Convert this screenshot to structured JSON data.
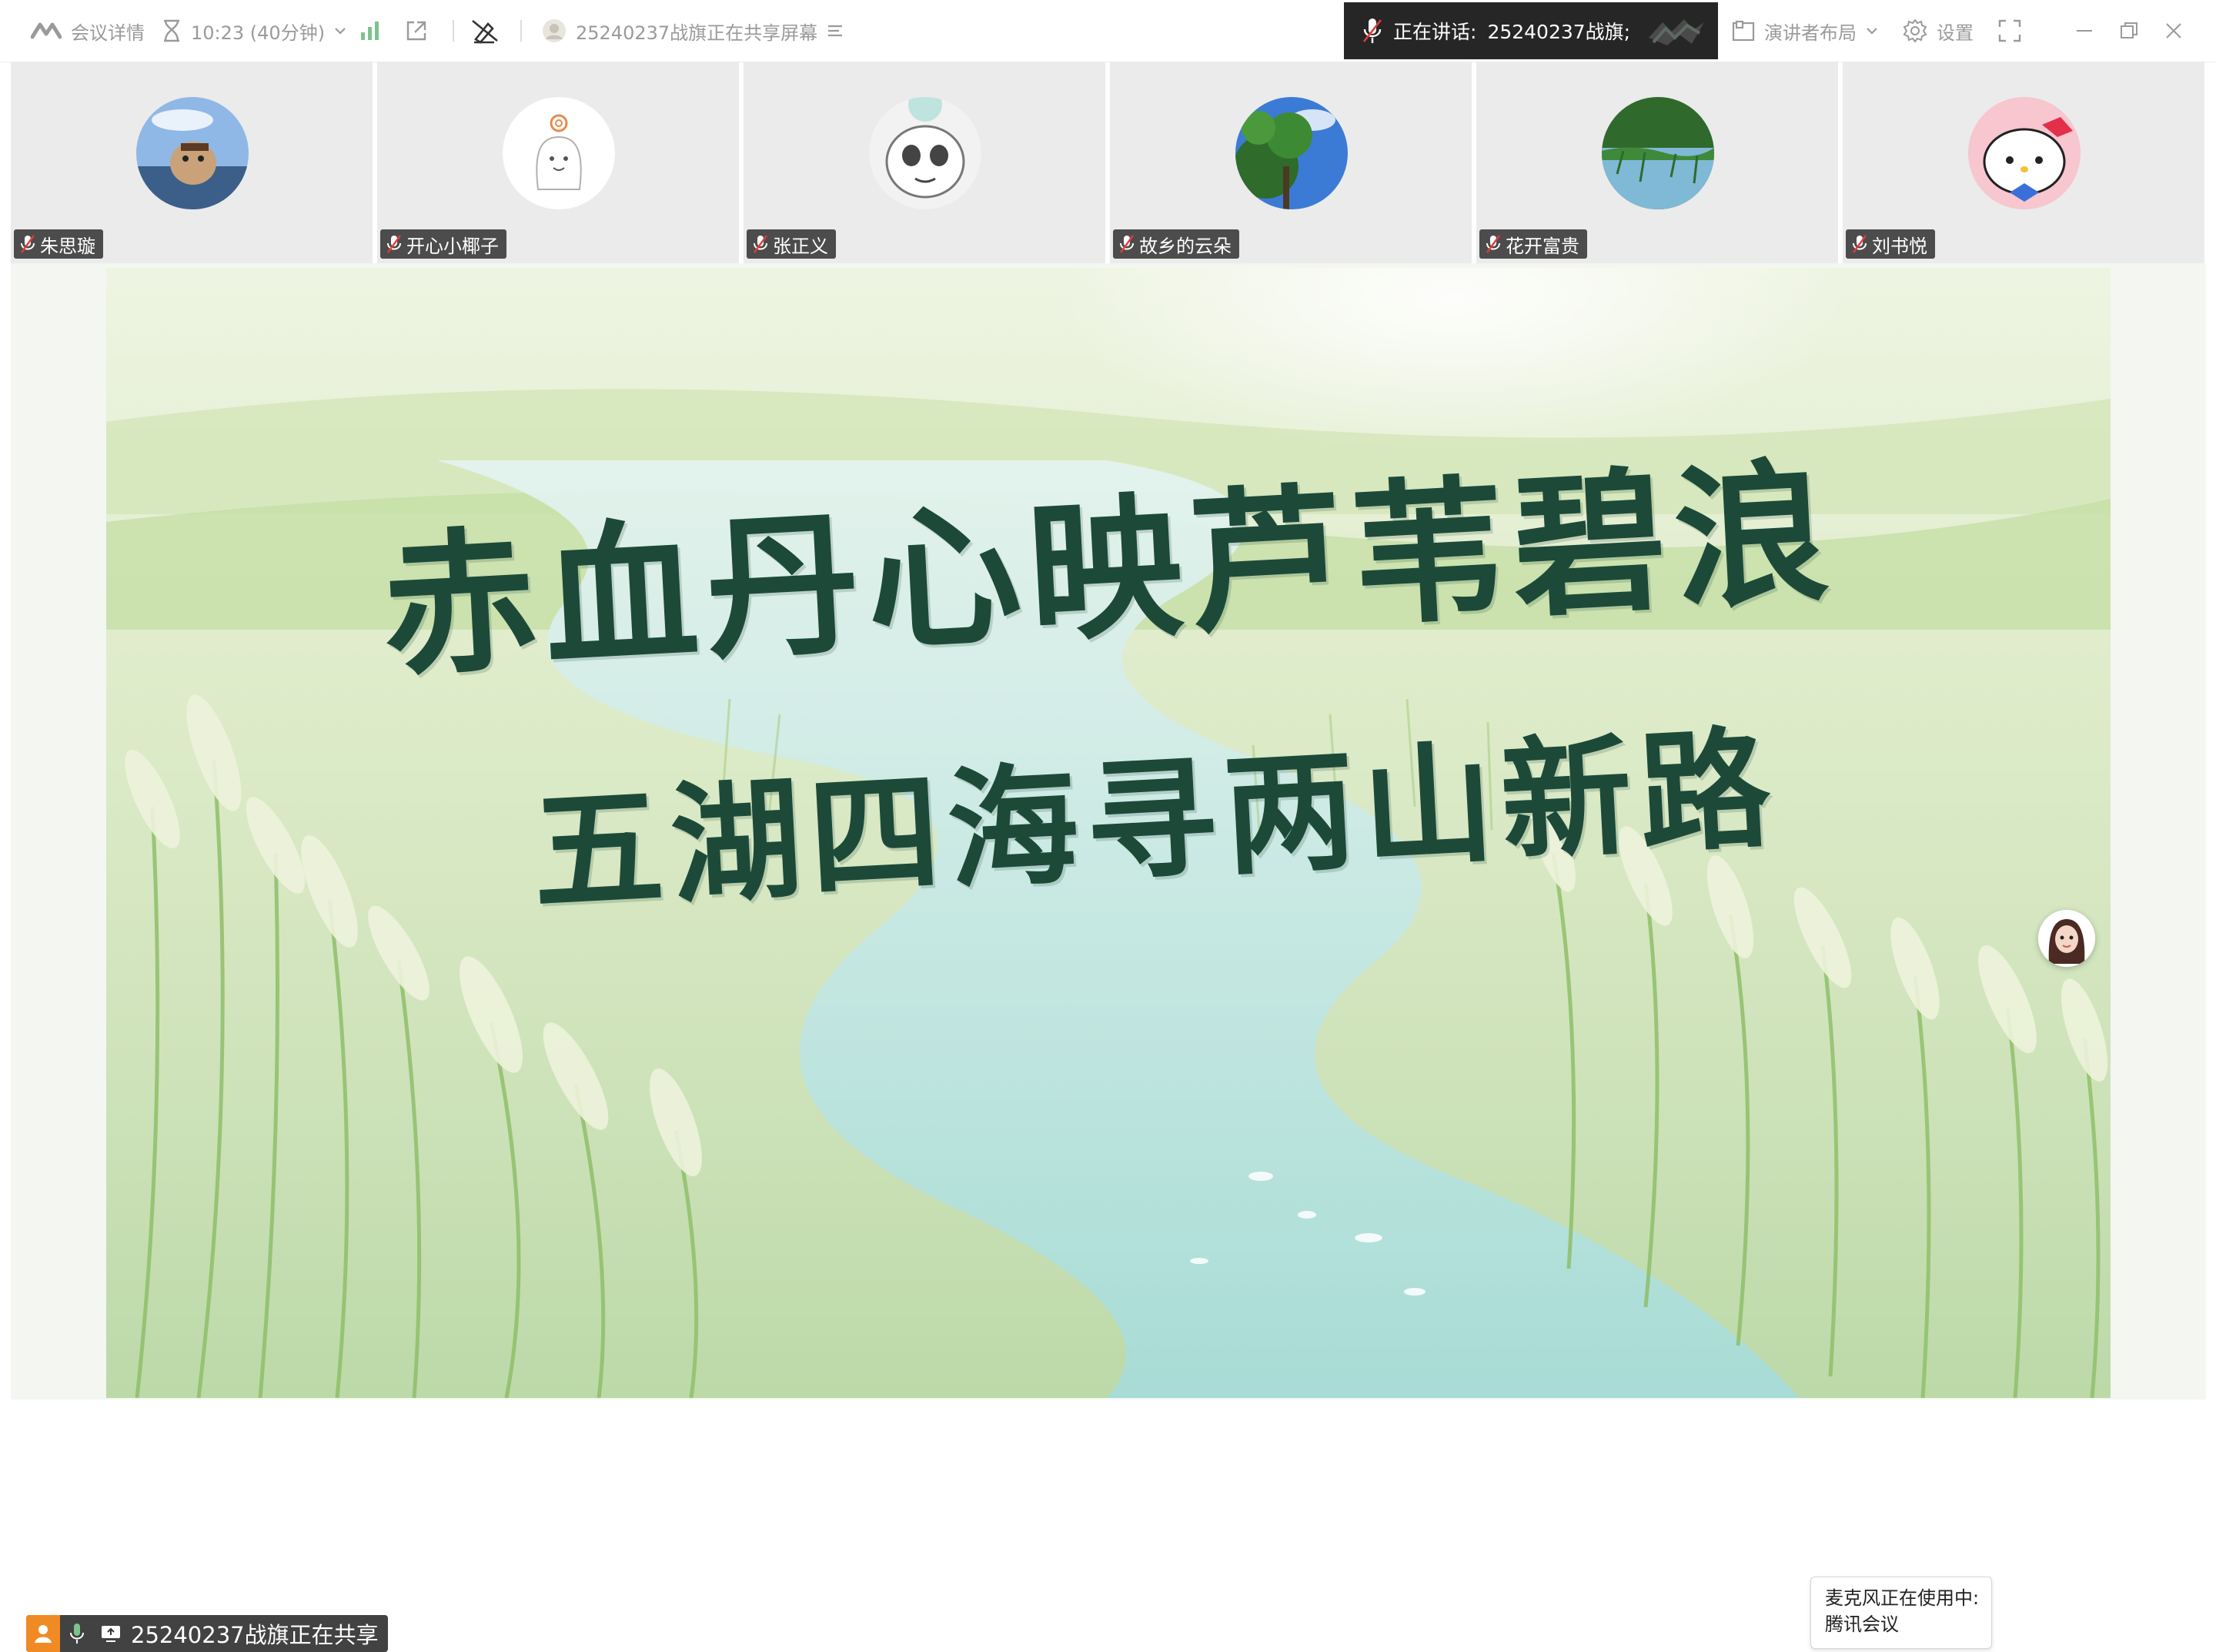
{
  "toolbar": {
    "meeting_details": "会议详情",
    "timer": "10:23 (40分钟)",
    "share_status": "25240237战旗正在共享屏幕",
    "speaking_label": "正在讲话:",
    "speaking_name": "25240237战旗;",
    "layout": "演讲者布局",
    "settings": "设置"
  },
  "participants": [
    {
      "name": "朱思璇",
      "avatar": "dog-car-photo"
    },
    {
      "name": "开心小椰子",
      "avatar": "cartoon-ghost"
    },
    {
      "name": "张正义",
      "avatar": "panda-sketch"
    },
    {
      "name": "故乡的云朵",
      "avatar": "tree-sky-photo"
    },
    {
      "name": "花开富贵",
      "avatar": "lake-reeds-photo"
    },
    {
      "name": "刘书悦",
      "avatar": "hello-kitty"
    }
  ],
  "slide": {
    "line1": "赤血丹心映芦苇碧浪",
    "line2": "五湖四海寻两山新路"
  },
  "mic_toast": {
    "line1": "麦克风正在使用中:",
    "line2": "腾讯会议"
  },
  "share_badge": {
    "text": "25240237战旗正在共享"
  },
  "colors": {
    "calligraphy": "#1d4a38",
    "speaking_bg": "#262626",
    "share_badge_accent": "#f08a24"
  }
}
